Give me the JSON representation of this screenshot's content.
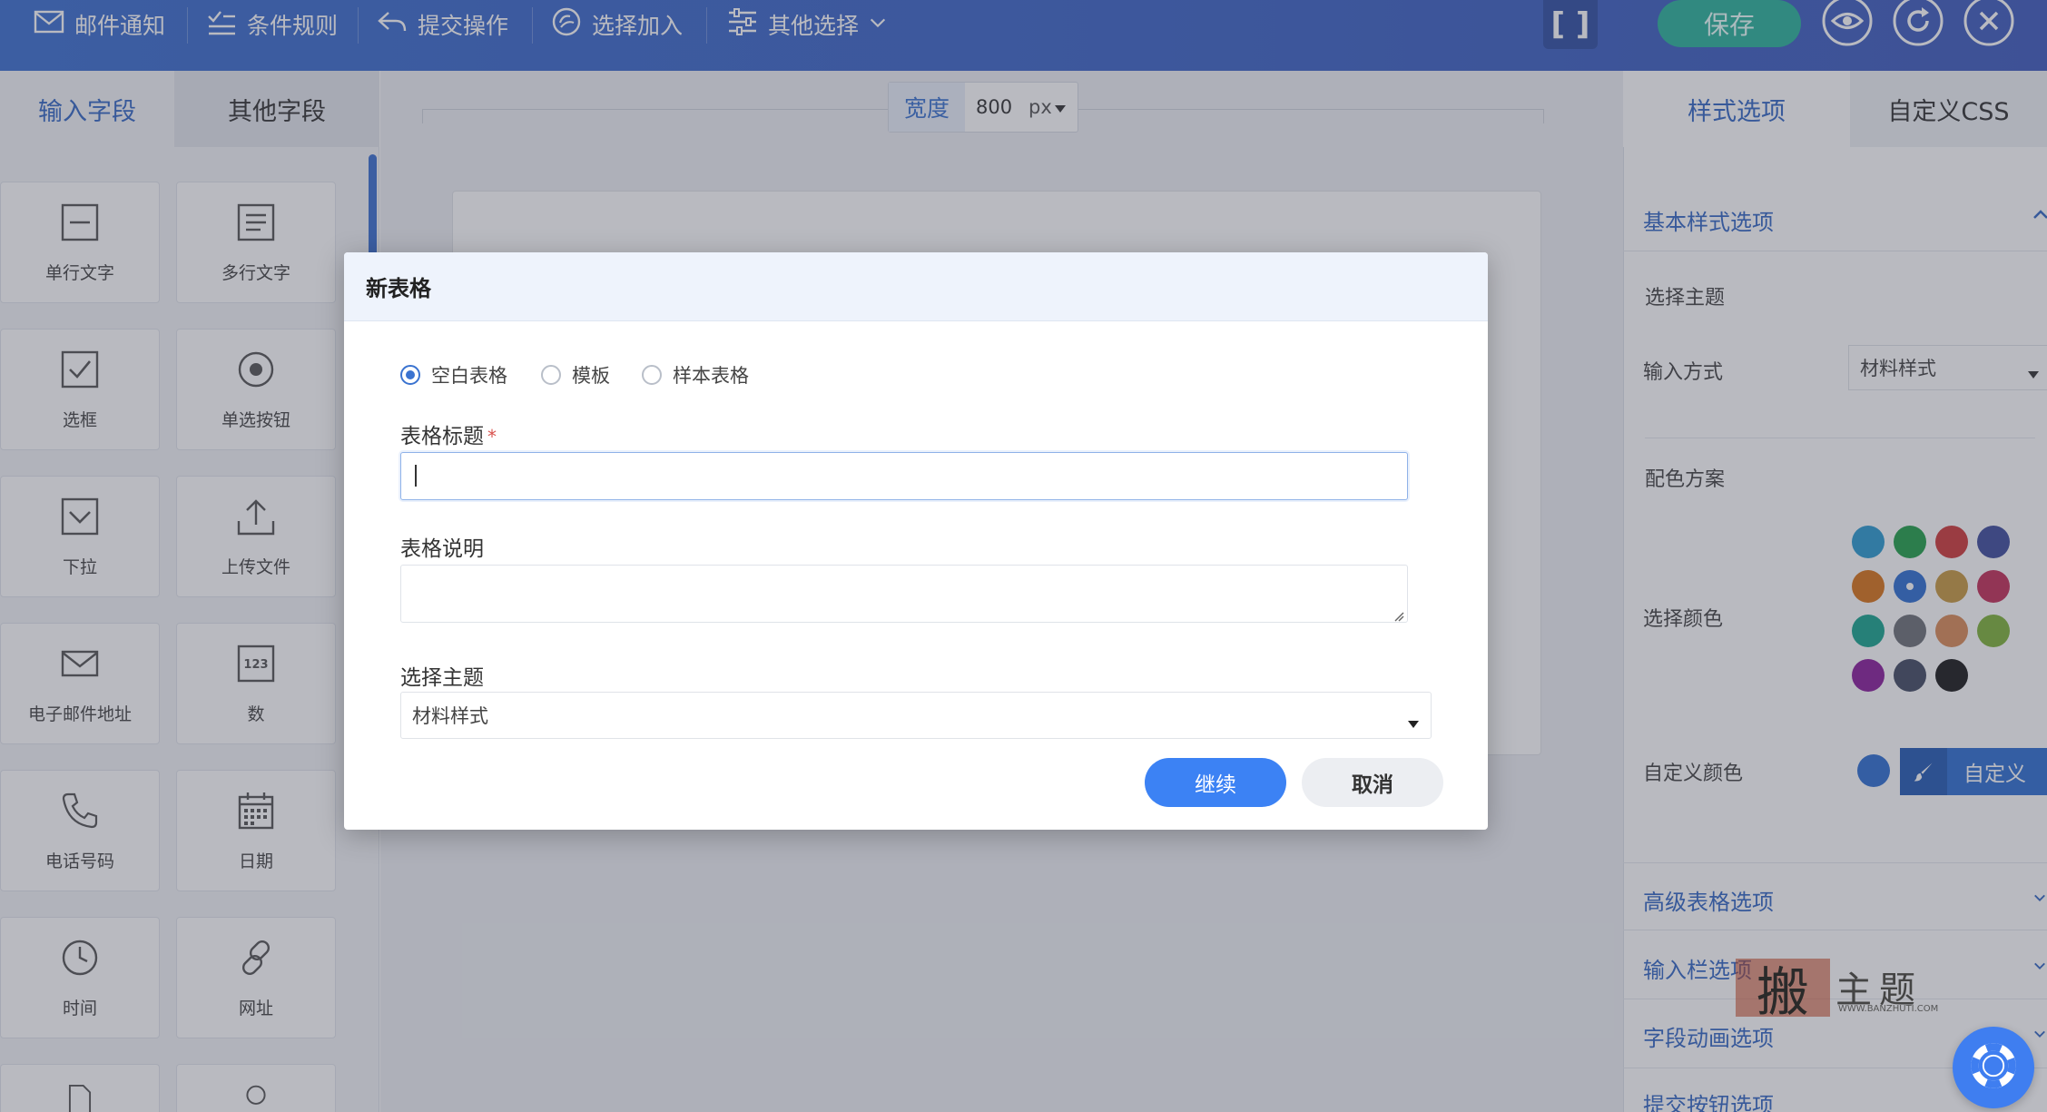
{
  "toolbar": {
    "items": [
      {
        "label": "邮件通知",
        "icon": "mail-icon"
      },
      {
        "label": "条件规则",
        "icon": "checklist-icon"
      },
      {
        "label": "提交操作",
        "icon": "reply-icon"
      },
      {
        "label": "选择加入",
        "icon": "opt-in-icon"
      },
      {
        "label": "其他选择",
        "icon": "sliders-icon"
      }
    ],
    "bracket": "[ ]",
    "save_label": "保存"
  },
  "left_panel": {
    "tabs": [
      "输入字段",
      "其他字段"
    ],
    "fields": [
      {
        "label": "单行文字",
        "icon": "single-line-icon"
      },
      {
        "label": "多行文字",
        "icon": "multi-line-icon"
      },
      {
        "label": "选框",
        "icon": "checkbox-icon"
      },
      {
        "label": "单选按钮",
        "icon": "radio-icon"
      },
      {
        "label": "下拉",
        "icon": "dropdown-icon"
      },
      {
        "label": "上传文件",
        "icon": "upload-icon"
      },
      {
        "label": "电子邮件地址",
        "icon": "mail-icon"
      },
      {
        "label": "数",
        "icon": "number-icon"
      },
      {
        "label": "电话号码",
        "icon": "phone-icon"
      },
      {
        "label": "日期",
        "icon": "calendar-icon"
      },
      {
        "label": "时间",
        "icon": "clock-icon"
      },
      {
        "label": "网址",
        "icon": "link-icon"
      }
    ],
    "number_icon_text": "123"
  },
  "canvas": {
    "width_label": "宽度",
    "width_value": "800",
    "width_unit": "px"
  },
  "right_panel": {
    "tabs": [
      "样式选项",
      "自定义CSS"
    ],
    "basic_title": "基本样式选项",
    "theme_label": "选择主题",
    "input_mode_label": "输入方式",
    "input_mode_value": "材料样式",
    "color_scheme_label": "配色方案",
    "choose_color_label": "选择颜色",
    "custom_color_label": "自定义颜色",
    "custom_btn_label": "自定义",
    "colors": [
      "#2d9bd0",
      "#23a04a",
      "#cf3b3b",
      "#3f4e9d",
      "#d8741a",
      "#2f6fd2",
      "#c79a42",
      "#c23058",
      "#1aa58f",
      "#6e7178",
      "#d98b58",
      "#7fb23a",
      "#8a1f9c",
      "#444c63",
      "#1b1b1b"
    ],
    "custom_color": "#2f6fd2",
    "sections": [
      "高级表格选项",
      "输入栏选项",
      "字段动画选项",
      "提交按钮选项"
    ]
  },
  "modal": {
    "title": "新表格",
    "options": [
      "空白表格",
      "模板",
      "样本表格"
    ],
    "selected_option": 0,
    "form_title_label": "表格标题",
    "required_mark": "*",
    "form_title_value": "",
    "description_label": "表格说明",
    "description_value": "",
    "theme_label": "选择主题",
    "theme_value": "材料样式",
    "continue_label": "继续",
    "cancel_label": "取消"
  },
  "watermark": {
    "seal": "搬",
    "text": "主题",
    "url": "WWW.BANZHUTI.COM"
  }
}
